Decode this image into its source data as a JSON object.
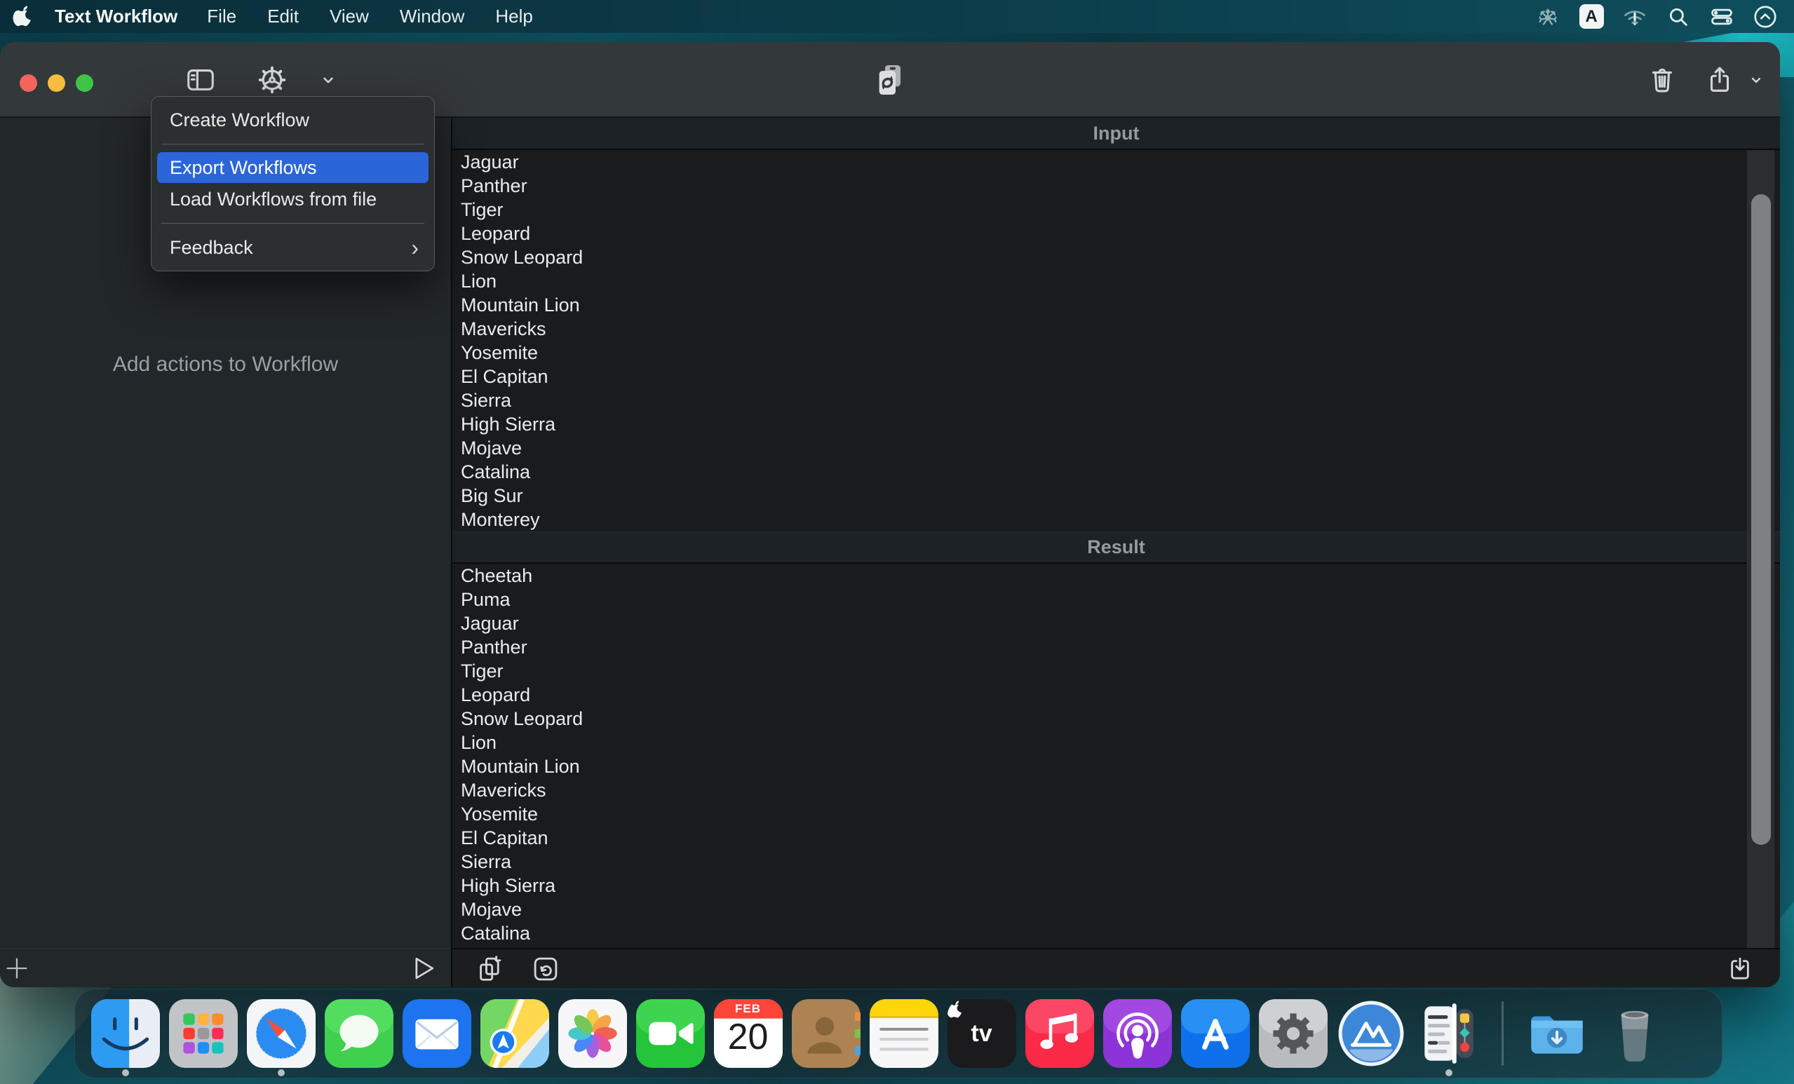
{
  "menubar": {
    "app_name": "Text Workflow",
    "menus": [
      "File",
      "Edit",
      "View",
      "Window",
      "Help"
    ],
    "input_source_label": "A",
    "status_icons": [
      "drweb-icon",
      "input-source-indicator",
      "wifi-alert-icon",
      "spotlight-icon",
      "control-center-icon",
      "bartender-icon"
    ]
  },
  "window": {
    "toolbar": {
      "icons": [
        "sidebar-toggle",
        "gear-menu",
        "sync-pages",
        "trash",
        "share"
      ]
    },
    "gear_menu": {
      "items": [
        {
          "label": "Create Workflow"
        },
        {
          "type": "separator"
        },
        {
          "label": "Export Workflows",
          "highlighted": true
        },
        {
          "label": "Load Workflows from file"
        },
        {
          "type": "separator"
        },
        {
          "label": "Feedback",
          "submenu": true
        }
      ]
    },
    "left_panel": {
      "placeholder": "Add actions to Workflow"
    },
    "input_section": {
      "title": "Input",
      "items": [
        "Jaguar",
        "Panther",
        "Tiger",
        "Leopard",
        "Snow Leopard",
        "Lion",
        "Mountain Lion",
        "Mavericks",
        "Yosemite",
        "El Capitan",
        "Sierra",
        "High Sierra",
        "Mojave",
        "Catalina",
        "Big Sur",
        "Monterey"
      ]
    },
    "result_section": {
      "title": "Result",
      "items": [
        "Cheetah",
        "Puma",
        "Jaguar",
        "Panther",
        "Tiger",
        "Leopard",
        "Snow Leopard",
        "Lion",
        "Mountain Lion",
        "Mavericks",
        "Yosemite",
        "El Capitan",
        "Sierra",
        "High Sierra",
        "Mojave",
        "Catalina"
      ]
    }
  },
  "dock": {
    "calendar_month": "FEB",
    "calendar_day": "20",
    "appletv_label": "tv",
    "items": [
      {
        "icon": "finder",
        "running": true
      },
      {
        "icon": "launchpad"
      },
      {
        "icon": "safari",
        "running": true
      },
      {
        "icon": "messages"
      },
      {
        "icon": "mail"
      },
      {
        "icon": "maps"
      },
      {
        "icon": "photos"
      },
      {
        "icon": "facetime"
      },
      {
        "icon": "calendar"
      },
      {
        "icon": "contacts"
      },
      {
        "icon": "notes"
      },
      {
        "icon": "appletv"
      },
      {
        "icon": "music"
      },
      {
        "icon": "podcasts"
      },
      {
        "icon": "appstore"
      },
      {
        "icon": "settings"
      },
      {
        "icon": "appcleaner"
      },
      {
        "icon": "textworkflow",
        "running": true
      },
      {
        "icon": "separator"
      },
      {
        "icon": "downloads"
      },
      {
        "icon": "trash"
      }
    ]
  },
  "colors": {
    "accent_blue": "#2a65d9",
    "toolbar_gray": "#33383b",
    "list_background": "#1a1b1c",
    "desktop_teal": "#0f5260"
  }
}
